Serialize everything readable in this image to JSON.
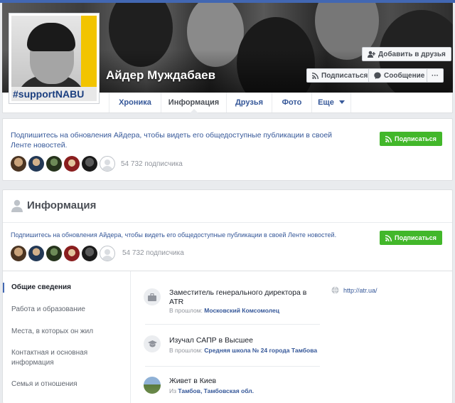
{
  "profile": {
    "name": "Айдер Муждабаев",
    "avatar_tag": "#supportNABU"
  },
  "cover_buttons": {
    "add_friend": "Добавить в друзья",
    "subscribe": "Подписаться",
    "message": "Сообщение",
    "more": "···"
  },
  "tabs": [
    {
      "label": "Хроника"
    },
    {
      "label": "Информация"
    },
    {
      "label": "Друзья"
    },
    {
      "label": "Фото"
    },
    {
      "label": "Еще"
    }
  ],
  "follow_card": {
    "text": "Подпишитесь на обновления Айдера, чтобы видеть его общедоступные публикации в своей Ленте новостей.",
    "button": "Подписаться",
    "count": "54 732 подписчика"
  },
  "info": {
    "title": "Информация",
    "follow_text": "Подпишитесь на обновления Айдера, чтобы видеть его общедоступные публикации в своей Ленте новостей.",
    "follow_button": "Подписаться",
    "follow_count": "54 732 подписчика",
    "nav": [
      {
        "label": "Общие сведения"
      },
      {
        "label": "Работа и образование"
      },
      {
        "label": "Места, в которых он жил"
      },
      {
        "label": "Контактная и основная информация"
      },
      {
        "label": "Семья и отношения"
      }
    ],
    "entries": [
      {
        "title": "Заместитель генерального директора в ATR",
        "prefix": "В прошлом:",
        "detail": "Московский Комсомолец"
      },
      {
        "title": "Изучал САПР в Высшее",
        "prefix": "В прошлом:",
        "detail": "Средняя школа № 24 города Тамбова"
      },
      {
        "title": "Живет в Киев",
        "prefix": "Из",
        "detail": "Тамбов, Тамбовская обл."
      }
    ],
    "website": "http://atr.ua/"
  },
  "colors": {
    "brand": "#4267b2",
    "link": "#365899",
    "green": "#42b72a"
  }
}
